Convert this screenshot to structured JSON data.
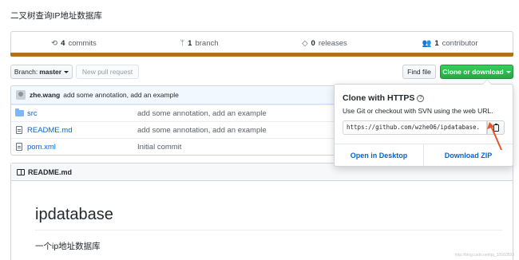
{
  "repo": {
    "description": "二叉树查询IP地址数据库"
  },
  "stats": {
    "commits": {
      "count": "4",
      "label": "commits"
    },
    "branches": {
      "count": "1",
      "label": "branch"
    },
    "releases": {
      "count": "0",
      "label": "releases"
    },
    "contributors": {
      "count": "1",
      "label": "contributor"
    }
  },
  "language_bar_color": "#b07219",
  "toolbar": {
    "branch_prefix": "Branch:",
    "branch_name": "master",
    "new_pr_label": "New pull request",
    "find_file_label": "Find file",
    "clone_label": "Clone or download"
  },
  "latest_commit": {
    "author": "zhe.wang",
    "message": "add some annotation, add an example"
  },
  "files": [
    {
      "name": "src",
      "type": "folder",
      "message": "add some annotation, add an example"
    },
    {
      "name": "README.md",
      "type": "file",
      "message": "add some annotation, add an example"
    },
    {
      "name": "pom.xml",
      "type": "file",
      "message": "Initial commit"
    }
  ],
  "readme": {
    "header": "README.md",
    "title": "ipdatabase",
    "text": "一个ip地址数据库"
  },
  "clone_popover": {
    "title": "Clone with HTTPS",
    "description": "Use Git or checkout with SVN using the web URL.",
    "url": "https://github.com/wzhe06/ipdatabase.",
    "open_desktop_label": "Open in Desktop",
    "download_zip_label": "Download ZIP"
  },
  "watermark": "http://blog.csdn.net/qq_32660593",
  "colors": {
    "accent_green": "#28a745",
    "link_blue": "#0366d6",
    "annotation_arrow": "#e8552c"
  }
}
